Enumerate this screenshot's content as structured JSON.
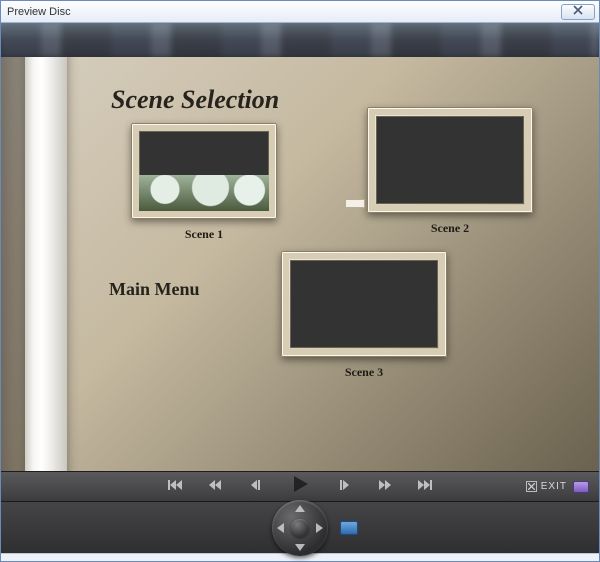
{
  "window": {
    "title": "Preview Disc"
  },
  "menu": {
    "heading": "Scene Selection",
    "main_menu_label": "Main Menu",
    "scenes": [
      {
        "label": "Scene 1"
      },
      {
        "label": "Scene 2"
      },
      {
        "label": "Scene 3"
      }
    ]
  },
  "controls": {
    "exit_label": "EXIT"
  }
}
